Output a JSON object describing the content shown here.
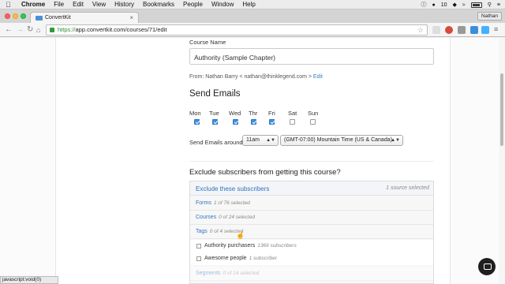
{
  "menubar": {
    "app_name": "Chrome",
    "items": [
      "File",
      "Edit",
      "View",
      "History",
      "Bookmarks",
      "People",
      "Window",
      "Help"
    ],
    "badge_num": "10"
  },
  "browser": {
    "tab_title": "ConvertKit",
    "user": "Nathan",
    "url_scheme": "https://",
    "url_rest": "app.convertkit.com/courses/71/edit"
  },
  "form": {
    "course_name_label": "Course Name",
    "course_name_value": "Authority (Sample Chapter)",
    "from_text": "From: Nathan Barry < nathan@thinklegend.com >",
    "from_edit": "Edit",
    "send_emails_heading": "Send Emails",
    "days": [
      {
        "label": "Mon",
        "checked": true
      },
      {
        "label": "Tue",
        "checked": true
      },
      {
        "label": "Wed",
        "checked": true
      },
      {
        "label": "Thr",
        "checked": true
      },
      {
        "label": "Fri",
        "checked": true
      },
      {
        "label": "Sat",
        "checked": false
      },
      {
        "label": "Sun",
        "checked": false
      }
    ],
    "send_around_label": "Send Emails around",
    "time_value": "11am",
    "timezone_value": "(GMT-07:00) Mountain Time (US & Canada)"
  },
  "exclude": {
    "heading": "Exclude subscribers from getting this course?",
    "panel_title": "Exclude these subscribers",
    "panel_count": "1 source selected",
    "filters": [
      {
        "name": "Forms",
        "count": "1 of 76 selected"
      },
      {
        "name": "Courses",
        "count": "0 of 24 selected"
      },
      {
        "name": "Tags",
        "count": "0 of 4 selected"
      }
    ],
    "tag_items": [
      {
        "name": "Authority purchasers",
        "count": "1369 subscribers"
      },
      {
        "name": "Awesome people",
        "count": "1 subscriber"
      }
    ],
    "segments": {
      "name": "Segments",
      "count": "0 of 14 selected"
    }
  },
  "status_bar": "javascript:void(0)"
}
